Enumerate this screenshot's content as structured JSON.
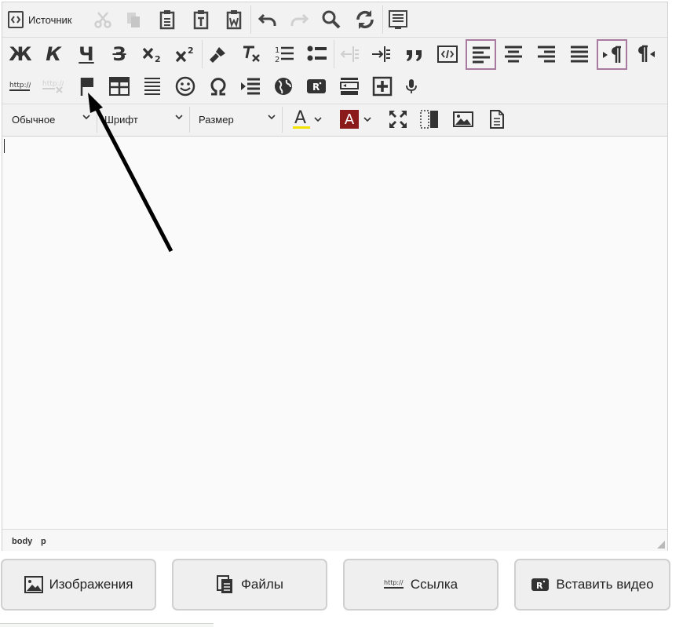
{
  "toolbar": {
    "source_label": "Источник",
    "bold_glyph": "Ж",
    "italic_glyph": "К",
    "underline_glyph": "Ч",
    "strike_glyph": "З",
    "link_text": "http://",
    "format_combo": "Обычное",
    "font_combo": "Шрифт",
    "size_combo": "Размер",
    "text_color_glyph": "A",
    "bg_color_glyph": "A",
    "accent_active": "#a87aa0",
    "bg_color_fill": "#8b1a1a"
  },
  "status": {
    "path": [
      "body",
      "p"
    ]
  },
  "actions": {
    "images": "Изображения",
    "files": "Файлы",
    "link": "Ссылка",
    "video": "Вставить видео"
  }
}
